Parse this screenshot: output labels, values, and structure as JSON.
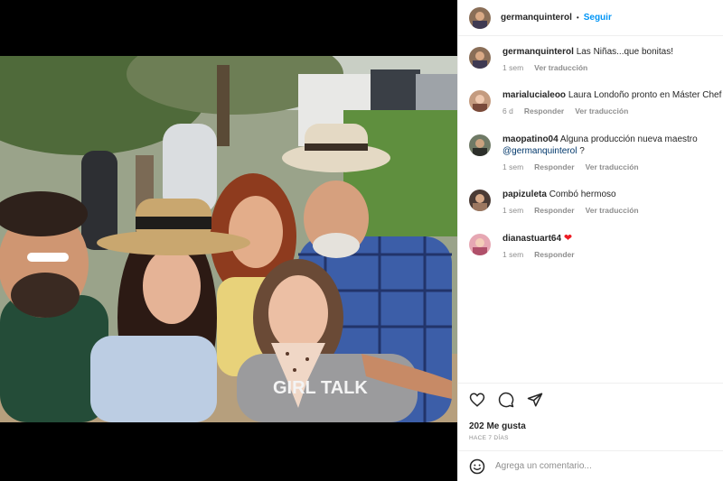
{
  "post": {
    "author": "germanquinterol",
    "follow_label": "Seguir",
    "separator": "•"
  },
  "photo": {
    "caption_on_shirt": "GIRL TALK"
  },
  "comments": [
    {
      "user": "germanquinterol",
      "text": "Las Niñas...que bonitas!",
      "time": "1 sem",
      "actions": [
        "Ver traducción"
      ]
    },
    {
      "user": "marialucialeoo",
      "text": "Laura Londoño pronto en Máster Chef",
      "time": "6 d",
      "actions": [
        "Responder",
        "Ver traducción"
      ]
    },
    {
      "user": "maopatino04",
      "text": "Alguna producción nueva maestro",
      "mention": "@germanquinterol",
      "text_after": "?",
      "time": "1 sem",
      "actions": [
        "Responder",
        "Ver traducción"
      ]
    },
    {
      "user": "papizuleta",
      "text": "Combó hermoso",
      "time": "1 sem",
      "actions": [
        "Responder",
        "Ver traducción"
      ]
    },
    {
      "user": "dianastuart64",
      "text": "",
      "emoji": "heart",
      "time": "1 sem",
      "actions": [
        "Responder"
      ]
    }
  ],
  "actions": {
    "likes": "202 Me gusta",
    "posted": "HACE 7 DÍAS"
  },
  "add_comment": {
    "placeholder": "Agrega un comentario..."
  },
  "icons": [
    "like-icon",
    "comment-icon",
    "share-icon",
    "emoji-icon"
  ],
  "colors": {
    "link": "#0095f6",
    "mention": "#00376b",
    "muted": "#8e8e8e",
    "heart": "#ed1c24"
  }
}
